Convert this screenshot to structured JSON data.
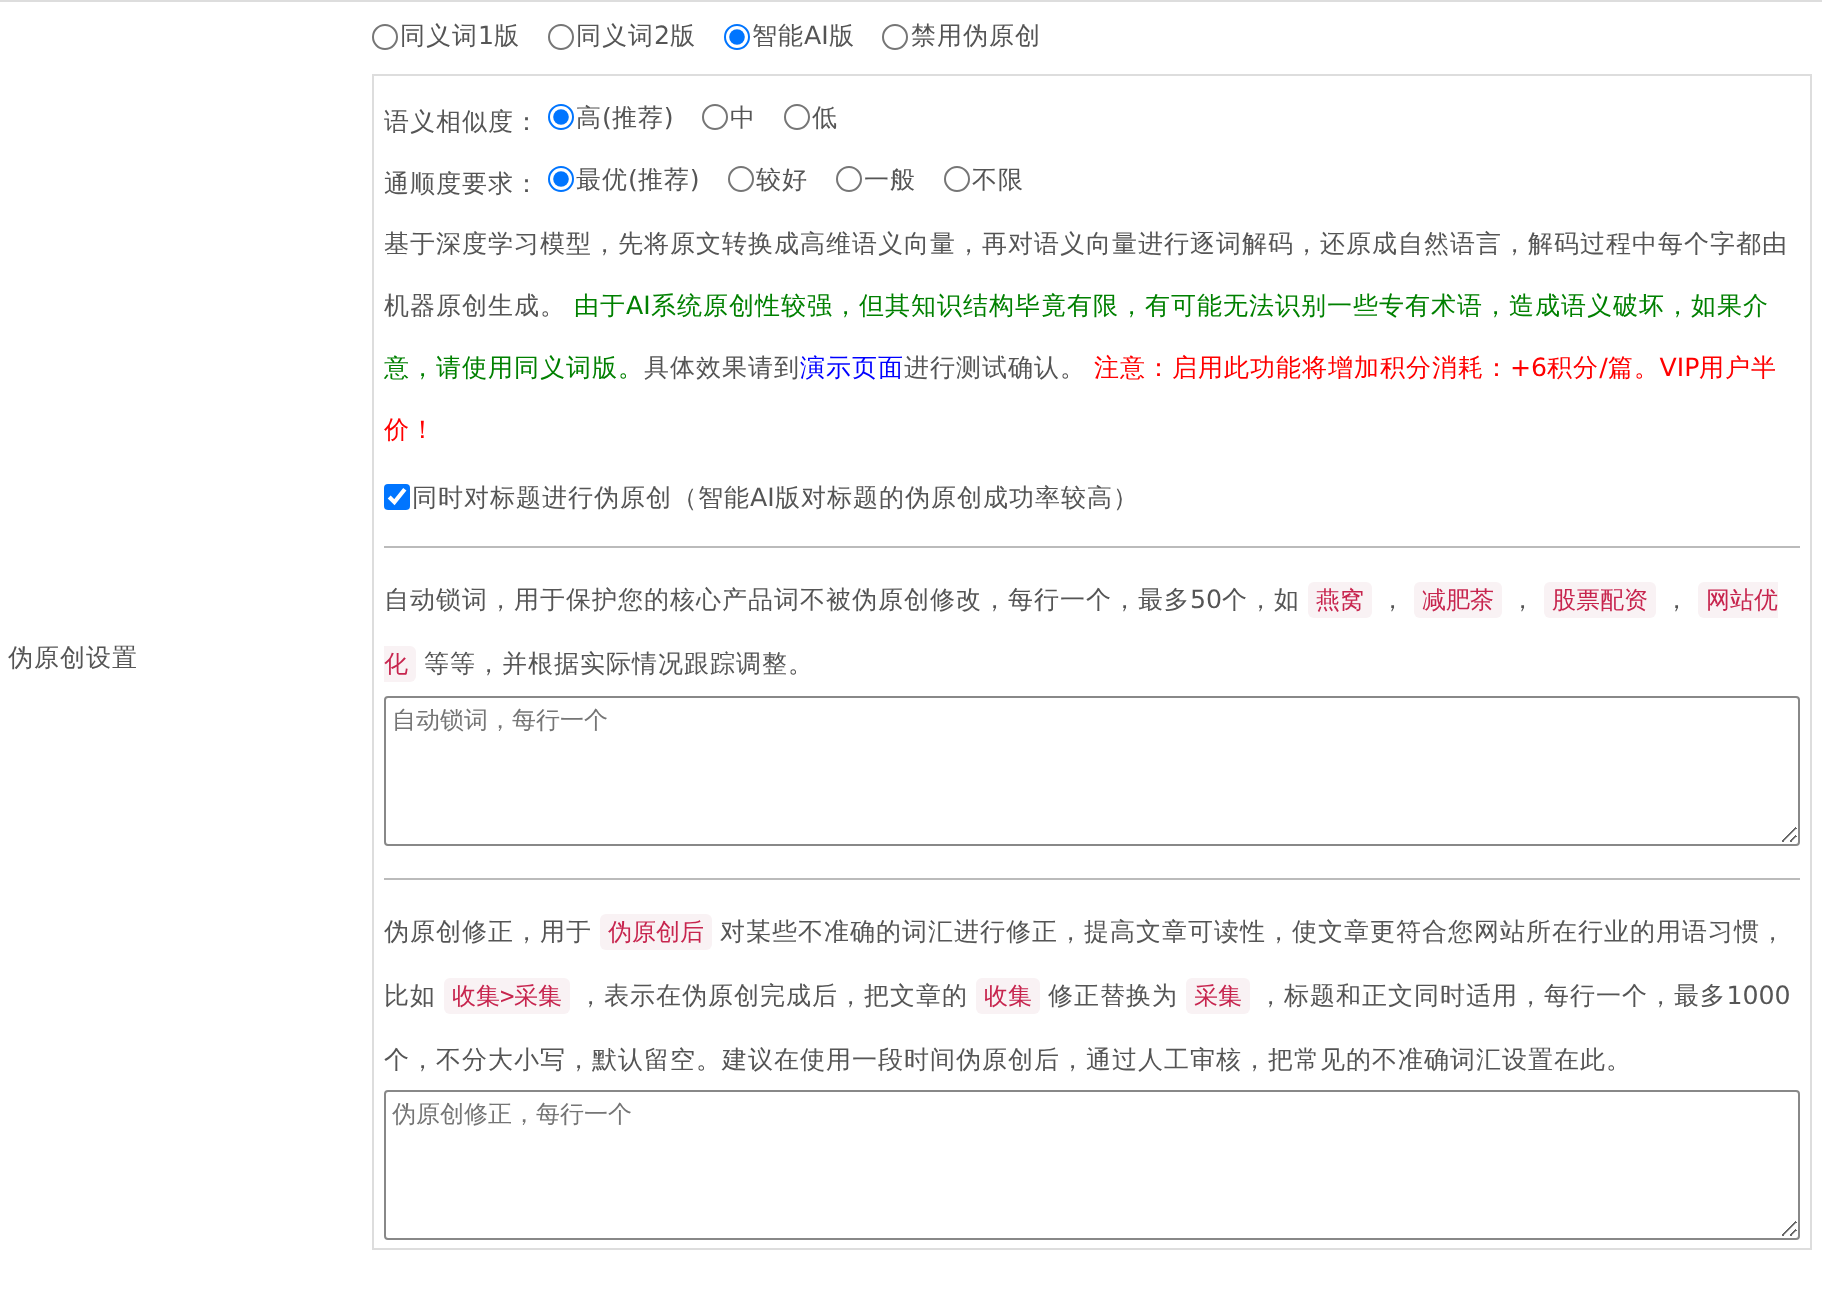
{
  "section_label": "伪原创设置",
  "modes": [
    {
      "label": "同义词1版",
      "selected": false
    },
    {
      "label": "同义词2版",
      "selected": false
    },
    {
      "label": "智能AI版",
      "selected": true
    },
    {
      "label": "禁用伪原创",
      "selected": false
    }
  ],
  "settings": [
    {
      "label": "语义相似度：",
      "options": [
        {
          "label": "高(推荐)",
          "selected": true
        },
        {
          "label": "中",
          "selected": false
        },
        {
          "label": "低",
          "selected": false
        }
      ]
    },
    {
      "label": "通顺度要求：",
      "options": [
        {
          "label": "最优(推荐)",
          "selected": true
        },
        {
          "label": "较好",
          "selected": false
        },
        {
          "label": "一般",
          "selected": false
        },
        {
          "label": "不限",
          "selected": false
        }
      ]
    }
  ],
  "description": [
    {
      "kind": "plain",
      "text": "基于深度学习模型，先将原文转换成高维语义向量，再对语义向量进行逐词解码，还原成自然语言，解码过程中每个字都由机器原创生成。"
    },
    {
      "kind": "success",
      "text": "由于AI系统原创性较强，但其知识结构毕竟有限，有可能无法识别一些专有术语，造成语义破坏，如果介意，请使用同义词版。"
    },
    {
      "kind": "plain",
      "text": "具体效果请到"
    },
    {
      "kind": "link",
      "text": "演示页面"
    },
    {
      "kind": "plain",
      "text": "进行测试确认。"
    },
    {
      "kind": "warning",
      "text": "注意：启用此功能将增加积分消耗：+6积分/篇。VIP用户半价！"
    }
  ],
  "title_option": {
    "label": "同时对标题进行伪原创（智能AI版对标题的伪原创成功率较高）",
    "checked": true
  },
  "lock_words": {
    "segments": [
      {
        "kind": "text",
        "text": "自动锁词，用于保护您的核心产品词不被伪原创修改，每行一个，最多50个，如"
      },
      {
        "kind": "tag",
        "text": "燕窝"
      },
      {
        "kind": "text",
        "text": "，"
      },
      {
        "kind": "tag",
        "text": "减肥茶"
      },
      {
        "kind": "text",
        "text": "，"
      },
      {
        "kind": "tag",
        "text": "股票配资"
      },
      {
        "kind": "text",
        "text": "，"
      },
      {
        "kind": "tag",
        "text": "网站优化"
      },
      {
        "kind": "text",
        "text": "等等，并根据实际情况跟踪调整。"
      }
    ],
    "placeholder": "自动锁词，每行一个"
  },
  "correction": {
    "segments": [
      {
        "kind": "text",
        "text": "伪原创修正，用于"
      },
      {
        "kind": "tag",
        "text": "伪原创后"
      },
      {
        "kind": "text",
        "text": "对某些不准确的词汇进行修正，提高文章可读性，使文章更符合您网站所在行业的用语习惯，比如"
      },
      {
        "kind": "tag",
        "text": "收集>采集"
      },
      {
        "kind": "text",
        "text": "，表示在伪原创完成后，把文章的"
      },
      {
        "kind": "tag",
        "text": "收集"
      },
      {
        "kind": "text",
        "text": "修正替换为"
      },
      {
        "kind": "tag",
        "text": "采集"
      },
      {
        "kind": "text",
        "text": "，标题和正文同时适用，每行一个，最多1000个，不分大小写，默认留空。建议在使用一段时间伪原创后，通过人工审核，把常见的不准确词汇设置在此。"
      }
    ],
    "placeholder": "伪原创修正，每行一个"
  }
}
